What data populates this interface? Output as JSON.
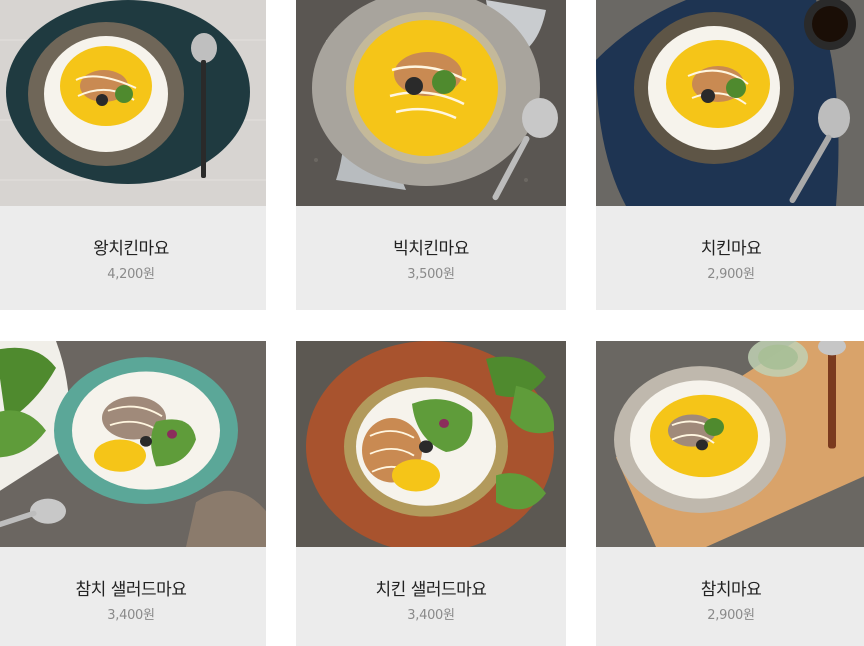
{
  "menu": {
    "items": [
      {
        "name": "왕치킨마요",
        "price": "4,200원"
      },
      {
        "name": "빅치킨마요",
        "price": "3,500원"
      },
      {
        "name": "치킨마요",
        "price": "2,900원"
      },
      {
        "name": "참치 샐러드마요",
        "price": "3,400원"
      },
      {
        "name": "치킨 샐러드마요",
        "price": "3,400원"
      },
      {
        "name": "참치마요",
        "price": "2,900원"
      }
    ]
  },
  "colors": {
    "card_info_bg": "#ececec",
    "name_text": "#222222",
    "price_text": "#8a8a8a",
    "egg_yellow": "#f5c518",
    "rice_white": "#f6f3ec"
  }
}
